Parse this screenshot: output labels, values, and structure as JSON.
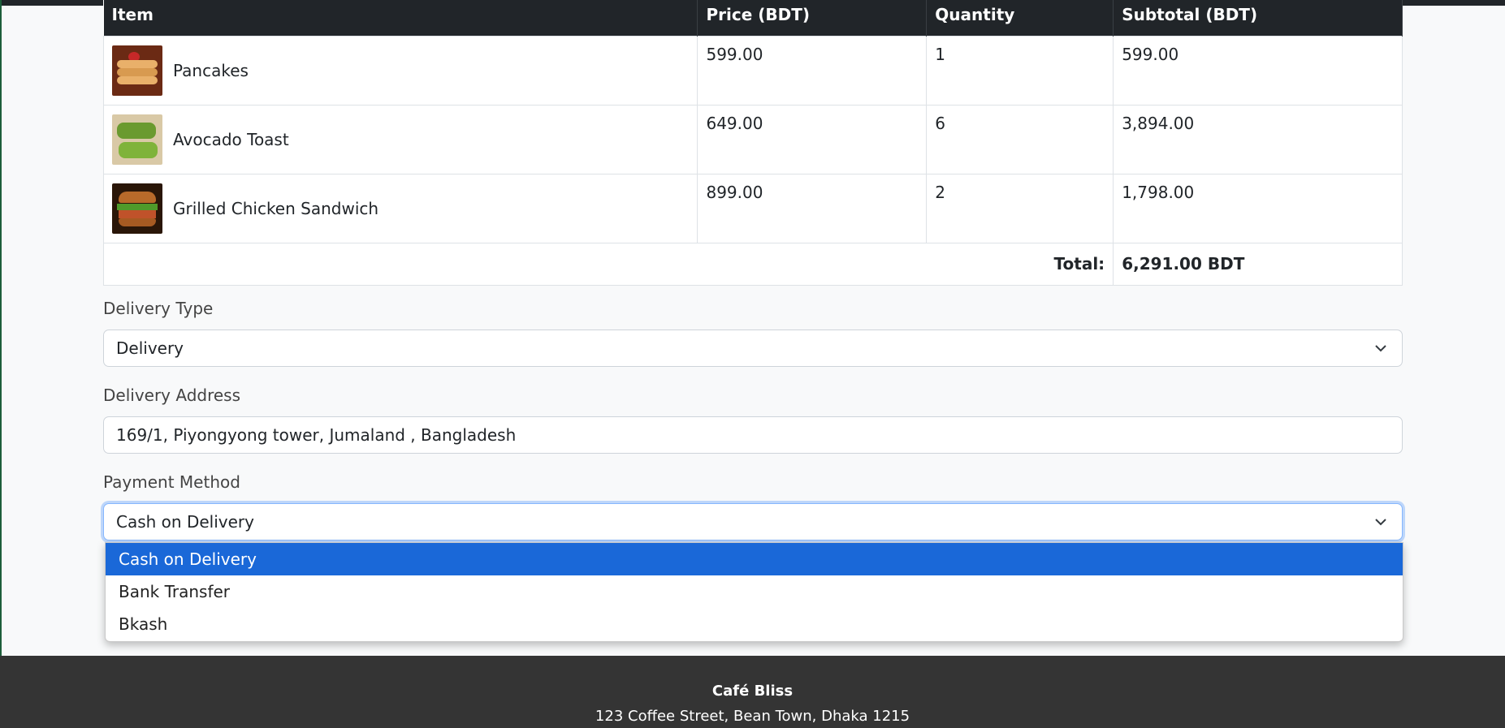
{
  "cart": {
    "headers": {
      "item": "Item",
      "price": "Price (BDT)",
      "quantity": "Quantity",
      "subtotal": "Subtotal (BDT)"
    },
    "rows": [
      {
        "name": "Pancakes",
        "price": "599.00",
        "quantity": "1",
        "subtotal": "599.00",
        "image": "pancakes-photo"
      },
      {
        "name": "Avocado Toast",
        "price": "649.00",
        "quantity": "6",
        "subtotal": "3,894.00",
        "image": "avocado-toast-photo"
      },
      {
        "name": "Grilled Chicken Sandwich",
        "price": "899.00",
        "quantity": "2",
        "subtotal": "1,798.00",
        "image": "grilled-chicken-sandwich-photo"
      }
    ],
    "total_label": "Total:",
    "total_value": "6,291.00 BDT"
  },
  "delivery_type": {
    "label": "Delivery Type",
    "value": "Delivery"
  },
  "delivery_address": {
    "label": "Delivery Address",
    "value": "169/1, Piyongyong tower, Jumaland , Bangladesh"
  },
  "payment_method": {
    "label": "Payment Method",
    "value": "Cash on Delivery",
    "options": [
      "Cash on Delivery",
      "Bank Transfer",
      "Bkash"
    ],
    "selected_index": 0
  },
  "footer": {
    "name": "Café Bliss",
    "address": "123 Coffee Street, Bean Town, Dhaka 1215"
  },
  "colors": {
    "header_bg": "#212529",
    "selected_option": "#1a68d8",
    "footer_bg": "#343434"
  }
}
